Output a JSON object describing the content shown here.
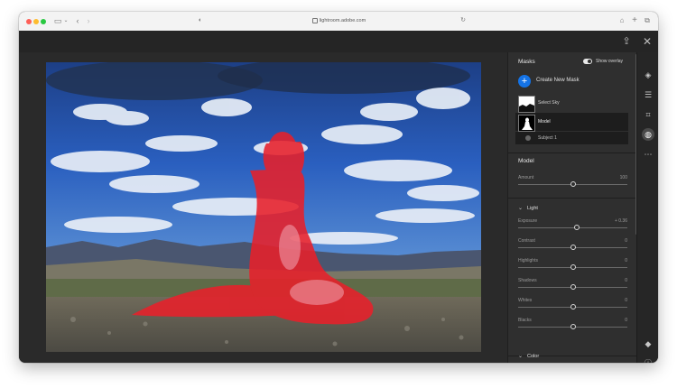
{
  "browser": {
    "url": "lightroom.adobe.com",
    "sidebar_icon": "sidebar-icon",
    "back_icon": "chevron-left-icon",
    "forward_icon": "chevron-right-icon",
    "shield_icon": "privacy-shield-icon",
    "reload_icon": "reload-icon",
    "home_icon": "home-icon",
    "newtab_icon": "plus-icon",
    "tabs_icon": "tab-overview-icon"
  },
  "topbar": {
    "share_icon": "share-icon",
    "close_icon": "close-icon"
  },
  "masks_panel": {
    "title": "Masks",
    "show_overlay_label": "Show overlay",
    "show_overlay_on": true,
    "create_label": "Create New Mask",
    "masks": [
      {
        "label": "Select Sky",
        "selected": false
      },
      {
        "label": "Model",
        "selected": true
      }
    ],
    "component_label": "Subject 1"
  },
  "adjust": {
    "section_title": "Model",
    "amount": {
      "label": "Amount",
      "value": "100",
      "position": 1.0
    },
    "light_heading": "Light",
    "color_heading": "Color",
    "sliders": [
      {
        "label": "Exposure",
        "value": "+ 0.36",
        "position": 0.54
      },
      {
        "label": "Contrast",
        "value": "0",
        "position": 0.5
      },
      {
        "label": "Highlights",
        "value": "0",
        "position": 0.5
      },
      {
        "label": "Shadows",
        "value": "0",
        "position": 0.5
      },
      {
        "label": "Whites",
        "value": "0",
        "position": 0.5
      },
      {
        "label": "Blacks",
        "value": "0",
        "position": 0.5
      }
    ]
  },
  "toolstrip": {
    "tools": [
      "edit-presets-icon",
      "sliders-icon",
      "crop-rotate-icon",
      "masking-icon",
      "more-icon"
    ],
    "active": "masking-icon",
    "bottom_tools": [
      "tag-icon",
      "info-icon"
    ]
  },
  "colors": {
    "accent": "#1473e6",
    "overlay": "#e8202a",
    "panel_bg": "#2f2f2f"
  }
}
